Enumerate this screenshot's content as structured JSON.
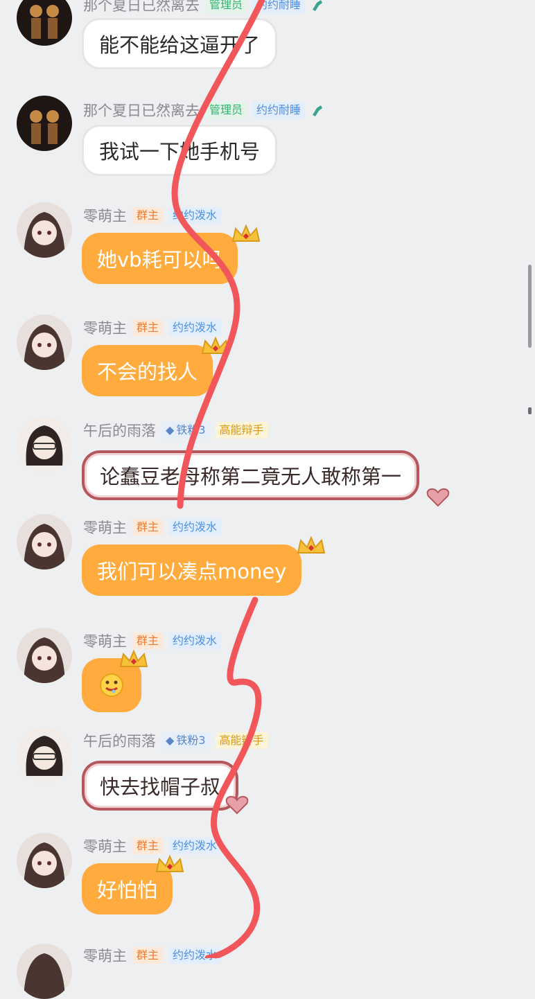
{
  "messages": [
    {
      "nickname": "那个夏日已然离去",
      "tags": [
        "管理员",
        "约约耐睡"
      ],
      "text": "能不能给这逼开了",
      "bubble": "white"
    },
    {
      "nickname": "那个夏日已然离去",
      "tags": [
        "管理员",
        "约约耐睡"
      ],
      "text": "我试一下她手机号",
      "bubble": "white"
    },
    {
      "nickname": "零萌主",
      "tags": [
        "群主",
        "约约泼水"
      ],
      "text": "她vb耗可以吗",
      "bubble": "orange"
    },
    {
      "nickname": "零萌主",
      "tags": [
        "群主",
        "约约泼水"
      ],
      "text": "不会的找人",
      "bubble": "orange"
    },
    {
      "nickname": "午后的雨落",
      "tags": [
        "铁粉3",
        "高能辩手"
      ],
      "text": "论蠢豆老母称第二竟无人敢称第一",
      "bubble": "pinkframe"
    },
    {
      "nickname": "零萌主",
      "tags": [
        "群主",
        "约约泼水"
      ],
      "text": "我们可以凑点money",
      "bubble": "orange"
    },
    {
      "nickname": "零萌主",
      "tags": [
        "群主",
        "约约泼水"
      ],
      "text": "",
      "emoji": "drooling-face-icon",
      "bubble": "orange"
    },
    {
      "nickname": "午后的雨落",
      "tags": [
        "铁粉3",
        "高能辩手"
      ],
      "text": "快去找帽子叔",
      "bubble": "pinkframe"
    },
    {
      "nickname": "零萌主",
      "tags": [
        "群主",
        "约约泼水"
      ],
      "text": "好怕怕",
      "bubble": "orange"
    },
    {
      "nickname": "零萌主",
      "tags": [
        "群主",
        "约约泼水"
      ],
      "text": "",
      "bubble": "orange"
    }
  ],
  "colors": {
    "background": "#eeeff1",
    "orange_bubble": "#ffab3e",
    "admin_tag": "#2fb36a",
    "owner_tag": "#ee7a2c",
    "title_tag": "#4d8fe0",
    "annotation_line": "#f0565a"
  }
}
